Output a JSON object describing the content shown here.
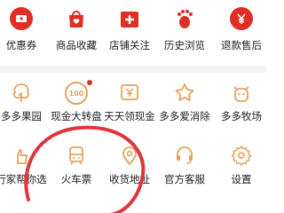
{
  "colors": {
    "accent": "#e02e24",
    "icon_orange": "#e8a25a",
    "text": "#222222"
  },
  "top_row": [
    {
      "label": "优惠券",
      "icon": "coupon-icon"
    },
    {
      "label": "商品收藏",
      "icon": "shopping-bag-heart-icon"
    },
    {
      "label": "店铺关注",
      "icon": "store-plus-icon"
    },
    {
      "label": "历史浏览",
      "icon": "footprint-icon"
    },
    {
      "label": "退款售后",
      "icon": "refund-yen-icon"
    }
  ],
  "middle_row": [
    {
      "label": "多多果园",
      "icon": "fruit-tree-icon"
    },
    {
      "label": "现金大转盘",
      "icon": "cash-wheel-icon",
      "badge": "100"
    },
    {
      "label": "天天领现金",
      "icon": "cash-envelope-icon"
    },
    {
      "label": "多多爱消除",
      "icon": "star-game-icon"
    },
    {
      "label": "多多牧场",
      "icon": "cow-icon"
    }
  ],
  "bottom_row": [
    {
      "label": "行家帮你选",
      "icon": "hand-pick-icon"
    },
    {
      "label": "火车票",
      "icon": "train-icon"
    },
    {
      "label": "收货地址",
      "icon": "location-pin-icon"
    },
    {
      "label": "官方客服",
      "icon": "customer-service-icon"
    },
    {
      "label": "设置",
      "icon": "gear-icon"
    }
  ]
}
